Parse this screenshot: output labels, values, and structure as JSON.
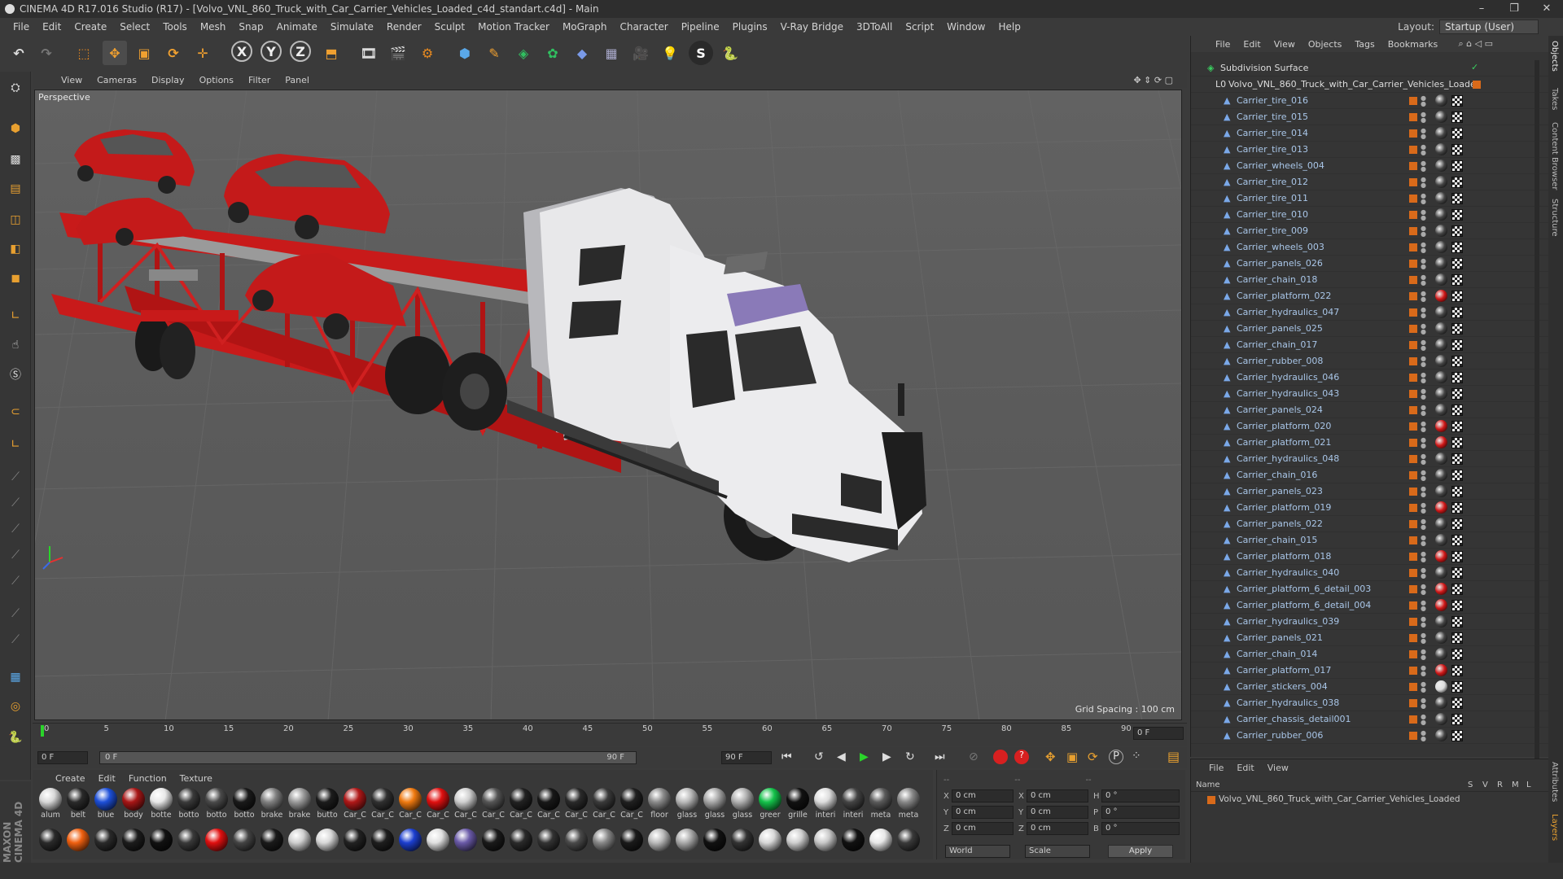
{
  "window": {
    "title": "CINEMA 4D R17.016 Studio (R17) - [Volvo_VNL_860_Truck_with_Car_Carrier_Vehicles_Loaded_c4d_standart.c4d] - Main",
    "layout_label": "Layout:",
    "layout_value": "Startup (User)"
  },
  "menu": [
    "File",
    "Edit",
    "Create",
    "Select",
    "Tools",
    "Mesh",
    "Snap",
    "Animate",
    "Simulate",
    "Render",
    "Sculpt",
    "Motion Tracker",
    "MoGraph",
    "Character",
    "Pipeline",
    "Plugins",
    "V-Ray Bridge",
    "3DToAll",
    "Script",
    "Window",
    "Help"
  ],
  "viewport": {
    "menu": [
      "View",
      "Cameras",
      "Display",
      "Options",
      "Filter",
      "Panel"
    ],
    "label": "Perspective",
    "grid_spacing": "Grid Spacing : 100 cm"
  },
  "timeline": {
    "ticks": [
      "0",
      "5",
      "10",
      "15",
      "20",
      "25",
      "30",
      "35",
      "40",
      "45",
      "50",
      "55",
      "60",
      "65",
      "70",
      "75",
      "80",
      "85",
      "90"
    ],
    "current_frame": "0 F",
    "start_field": "0 F",
    "slider_start": "0 F",
    "slider_end": "90 F",
    "end_field": "90 F"
  },
  "materials": {
    "menu": [
      "Create",
      "Edit",
      "Function",
      "Texture"
    ],
    "row1": [
      {
        "label": "alum",
        "color": "#d8d8d8"
      },
      {
        "label": "belt",
        "color": "#2a2a2a"
      },
      {
        "label": "blue",
        "color": "#1d4fd8"
      },
      {
        "label": "body",
        "color": "#a81616"
      },
      {
        "label": "botte",
        "color": "#e8e8e8"
      },
      {
        "label": "botto",
        "color": "#3a3a3a"
      },
      {
        "label": "botto",
        "color": "#4a4a4a"
      },
      {
        "label": "botto",
        "color": "#1a1a1a"
      },
      {
        "label": "brake",
        "color": "#808080"
      },
      {
        "label": "brake",
        "color": "#9a9a9a"
      },
      {
        "label": "butto",
        "color": "#1c1c1c"
      },
      {
        "label": "Car_C",
        "color": "#b01818"
      },
      {
        "label": "Car_C",
        "color": "#303030"
      },
      {
        "label": "Car_C",
        "color": "#f07a10"
      },
      {
        "label": "Car_C",
        "color": "#e01010"
      },
      {
        "label": "Car_C",
        "color": "#cfcfcf"
      },
      {
        "label": "Car_C",
        "color": "#555555"
      },
      {
        "label": "Car_C",
        "color": "#222222"
      },
      {
        "label": "Car_C",
        "color": "#181818"
      },
      {
        "label": "Car_C",
        "color": "#2a2a2a"
      },
      {
        "label": "Car_C",
        "color": "#3a3a3a"
      },
      {
        "label": "Car_C",
        "color": "#202020"
      },
      {
        "label": "floor",
        "color": "#8a8a8a"
      },
      {
        "label": "glass",
        "color": "#b9b9b9"
      },
      {
        "label": "glass",
        "color": "#a8a8a8"
      },
      {
        "label": "glass",
        "color": "#b0b0b0"
      },
      {
        "label": "greer",
        "color": "#14c24a"
      },
      {
        "label": "grille",
        "color": "#111111"
      },
      {
        "label": "interi",
        "color": "#dddddd"
      },
      {
        "label": "interi",
        "color": "#444444"
      },
      {
        "label": "meta",
        "color": "#5a5a5a"
      },
      {
        "label": "meta",
        "color": "#888888"
      }
    ],
    "row2": [
      "#2a2a2a",
      "#f06010",
      "#2a2a2a",
      "#1c1c1c",
      "#111111",
      "#3a3a3a",
      "#e01010",
      "#444444",
      "#1a1a1a",
      "#cfcfcf",
      "#d8d8d8",
      "#222222",
      "#1e1e1e",
      "#1c3fd0",
      "#e0e0e0",
      "#6a5aa8",
      "#1a1a1a",
      "#2a2a2a",
      "#333333",
      "#4a4a4a",
      "#888888",
      "#1a1a1a",
      "#bbbbbb",
      "#aaaaaa",
      "#111111",
      "#333333",
      "#d8d8d8",
      "#cfcfcf",
      "#c8c8c8",
      "#111111",
      "#e8e8e8",
      "#3a3a3a"
    ]
  },
  "coords": {
    "x_label": "X",
    "y_label": "Y",
    "z_label": "Z",
    "pos_x": "0 cm",
    "pos_y": "0 cm",
    "pos_z": "0 cm",
    "size_x": "0 cm",
    "size_y": "0 cm",
    "size_z": "0 cm",
    "h_label": "H",
    "p_label": "P",
    "b_label": "B",
    "rot_h": "0 °",
    "rot_p": "0 °",
    "rot_b": "0 °",
    "world": "World",
    "scale": "Scale",
    "apply": "Apply",
    "header_left": "--",
    "header_mid": "--",
    "header_right": "--"
  },
  "object_manager": {
    "menu": [
      "File",
      "Edit",
      "View",
      "Objects",
      "Tags",
      "Bookmarks"
    ],
    "root": "Subdivision Surface",
    "group": "Volvo_VNL_860_Truck_with_Car_Carrier_Vehicles_Loaded",
    "items": [
      {
        "name": "Carrier_tire_016",
        "tag": "dark"
      },
      {
        "name": "Carrier_tire_015",
        "tag": "dark"
      },
      {
        "name": "Carrier_tire_014",
        "tag": "dark"
      },
      {
        "name": "Carrier_tire_013",
        "tag": "dark"
      },
      {
        "name": "Carrier_wheels_004",
        "tag": "dark"
      },
      {
        "name": "Carrier_tire_012",
        "tag": "dark"
      },
      {
        "name": "Carrier_tire_011",
        "tag": "dark"
      },
      {
        "name": "Carrier_tire_010",
        "tag": "dark"
      },
      {
        "name": "Carrier_tire_009",
        "tag": "dark"
      },
      {
        "name": "Carrier_wheels_003",
        "tag": "dark"
      },
      {
        "name": "Carrier_panels_026",
        "tag": "dark"
      },
      {
        "name": "Carrier_chain_018",
        "tag": "dark"
      },
      {
        "name": "Carrier_platform_022",
        "tag": "red"
      },
      {
        "name": "Carrier_hydraulics_047",
        "tag": "dark"
      },
      {
        "name": "Carrier_panels_025",
        "tag": "dark"
      },
      {
        "name": "Carrier_chain_017",
        "tag": "dark"
      },
      {
        "name": "Carrier_rubber_008",
        "tag": "dark"
      },
      {
        "name": "Carrier_hydraulics_046",
        "tag": "dark"
      },
      {
        "name": "Carrier_hydraulics_043",
        "tag": "dark"
      },
      {
        "name": "Carrier_panels_024",
        "tag": "dark"
      },
      {
        "name": "Carrier_platform_020",
        "tag": "red"
      },
      {
        "name": "Carrier_platform_021",
        "tag": "red"
      },
      {
        "name": "Carrier_hydraulics_048",
        "tag": "dark"
      },
      {
        "name": "Carrier_chain_016",
        "tag": "dark"
      },
      {
        "name": "Carrier_panels_023",
        "tag": "dark"
      },
      {
        "name": "Carrier_platform_019",
        "tag": "red"
      },
      {
        "name": "Carrier_panels_022",
        "tag": "dark"
      },
      {
        "name": "Carrier_chain_015",
        "tag": "dark"
      },
      {
        "name": "Carrier_platform_018",
        "tag": "red"
      },
      {
        "name": "Carrier_hydraulics_040",
        "tag": "dark"
      },
      {
        "name": "Carrier_platform_6_detail_003",
        "tag": "red"
      },
      {
        "name": "Carrier_platform_6_detail_004",
        "tag": "red"
      },
      {
        "name": "Carrier_hydraulics_039",
        "tag": "dark"
      },
      {
        "name": "Carrier_panels_021",
        "tag": "dark"
      },
      {
        "name": "Carrier_chain_014",
        "tag": "dark"
      },
      {
        "name": "Carrier_platform_017",
        "tag": "red"
      },
      {
        "name": "Carrier_stickers_004",
        "tag": "light"
      },
      {
        "name": "Carrier_hydraulics_038",
        "tag": "dark"
      },
      {
        "name": "Carrier_chassis_detail001",
        "tag": "dark"
      },
      {
        "name": "Carrier_rubber_006",
        "tag": "dark"
      }
    ]
  },
  "attr_manager": {
    "menu": [
      "File",
      "Edit",
      "View"
    ],
    "col_name": "Name",
    "cols": [
      "S",
      "V",
      "R",
      "M",
      "L"
    ],
    "row": "Volvo_VNL_860_Truck_with_Car_Carrier_Vehicles_Loaded"
  },
  "right_tabs": [
    "Objects",
    "Takes",
    "Content Browser",
    "Structure",
    "Attributes",
    "Layers"
  ],
  "colors": {
    "accent": "#d96a1a",
    "truck_body": "#e8e8ea",
    "carrier_red": "#c81a1a",
    "visor": "#8a7ab8"
  }
}
